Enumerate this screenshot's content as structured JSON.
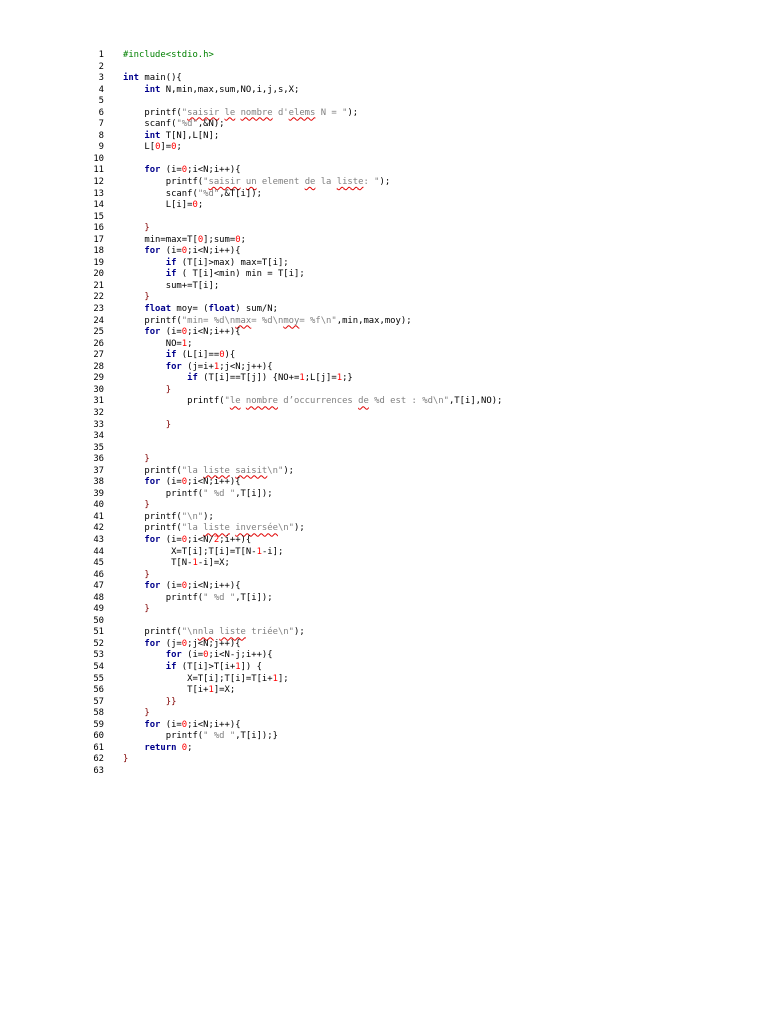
{
  "code": {
    "lines": [
      {
        "n": "1",
        "s": [
          {
            "t": "#include<stdio.h>",
            "c": "pp"
          }
        ]
      },
      {
        "n": "2",
        "s": []
      },
      {
        "n": "3",
        "s": [
          {
            "t": "int",
            "c": "kw"
          },
          {
            "t": " main(){"
          }
        ]
      },
      {
        "n": "4",
        "s": [
          {
            "t": "    "
          },
          {
            "t": "int",
            "c": "kw"
          },
          {
            "t": " N,min,max,sum,NO,i,j,s,X;"
          }
        ]
      },
      {
        "n": "5",
        "s": []
      },
      {
        "n": "6",
        "s": [
          {
            "t": "    printf("
          },
          {
            "t": "\"",
            "c": "str"
          },
          {
            "t": "saisir",
            "c": "str sq"
          },
          {
            "t": " ",
            "c": "str"
          },
          {
            "t": "le",
            "c": "str sq"
          },
          {
            "t": " ",
            "c": "str"
          },
          {
            "t": "nombre",
            "c": "str sq"
          },
          {
            "t": " d'",
            "c": "str"
          },
          {
            "t": "elems",
            "c": "str sq"
          },
          {
            "t": " N = \"",
            "c": "str"
          },
          {
            "t": ");"
          }
        ]
      },
      {
        "n": "7",
        "s": [
          {
            "t": "    scanf("
          },
          {
            "t": "\"%d\"",
            "c": "str"
          },
          {
            "t": ",&N);"
          }
        ]
      },
      {
        "n": "8",
        "s": [
          {
            "t": "    "
          },
          {
            "t": "int",
            "c": "kw"
          },
          {
            "t": " T[N],L[N];"
          }
        ]
      },
      {
        "n": "9",
        "s": [
          {
            "t": "    L["
          },
          {
            "t": "0",
            "c": "num"
          },
          {
            "t": "]="
          },
          {
            "t": "0",
            "c": "num"
          },
          {
            "t": ";"
          }
        ]
      },
      {
        "n": "10",
        "s": []
      },
      {
        "n": "11",
        "s": [
          {
            "t": "    "
          },
          {
            "t": "for",
            "c": "kw"
          },
          {
            "t": " (i="
          },
          {
            "t": "0",
            "c": "num"
          },
          {
            "t": ";i<N;i++){"
          }
        ]
      },
      {
        "n": "12",
        "s": [
          {
            "t": "        printf("
          },
          {
            "t": "\"",
            "c": "str"
          },
          {
            "t": "saisir",
            "c": "str sq"
          },
          {
            "t": " ",
            "c": "str"
          },
          {
            "t": "un",
            "c": "str sq"
          },
          {
            "t": " element ",
            "c": "str"
          },
          {
            "t": "de",
            "c": "str sq"
          },
          {
            "t": " la ",
            "c": "str"
          },
          {
            "t": "liste",
            "c": "str sq"
          },
          {
            "t": ": \"",
            "c": "str"
          },
          {
            "t": ");"
          }
        ]
      },
      {
        "n": "13",
        "s": [
          {
            "t": "        scanf("
          },
          {
            "t": "\"%d\"",
            "c": "str"
          },
          {
            "t": ",&T[i]);"
          }
        ]
      },
      {
        "n": "14",
        "s": [
          {
            "t": "        L[i]="
          },
          {
            "t": "0",
            "c": "num"
          },
          {
            "t": ";"
          }
        ]
      },
      {
        "n": "15",
        "s": []
      },
      {
        "n": "16",
        "s": [
          {
            "t": "    }",
            "c": "brace"
          }
        ]
      },
      {
        "n": "17",
        "s": [
          {
            "t": "    min=max=T["
          },
          {
            "t": "0",
            "c": "num"
          },
          {
            "t": "];sum="
          },
          {
            "t": "0",
            "c": "num"
          },
          {
            "t": ";"
          }
        ]
      },
      {
        "n": "18",
        "s": [
          {
            "t": "    "
          },
          {
            "t": "for",
            "c": "kw"
          },
          {
            "t": " (i="
          },
          {
            "t": "0",
            "c": "num"
          },
          {
            "t": ";i<N;i++){"
          }
        ]
      },
      {
        "n": "19",
        "s": [
          {
            "t": "        "
          },
          {
            "t": "if",
            "c": "kw"
          },
          {
            "t": " (T[i]>max) max=T[i];"
          }
        ]
      },
      {
        "n": "20",
        "s": [
          {
            "t": "        "
          },
          {
            "t": "if",
            "c": "kw"
          },
          {
            "t": " ( T[i]<min) min = T[i];"
          }
        ]
      },
      {
        "n": "21",
        "s": [
          {
            "t": "        sum+=T[i];"
          }
        ]
      },
      {
        "n": "22",
        "s": [
          {
            "t": "    }",
            "c": "brace"
          }
        ]
      },
      {
        "n": "23",
        "s": [
          {
            "t": "    "
          },
          {
            "t": "float",
            "c": "kw"
          },
          {
            "t": " moy= ("
          },
          {
            "t": "float",
            "c": "kw"
          },
          {
            "t": ") sum/N;"
          }
        ]
      },
      {
        "n": "24",
        "s": [
          {
            "t": "    printf("
          },
          {
            "t": "\"min= %d\\n",
            "c": "str"
          },
          {
            "t": "max",
            "c": "str sq"
          },
          {
            "t": "= %d\\n",
            "c": "str"
          },
          {
            "t": "moy",
            "c": "str sq"
          },
          {
            "t": "= %f\\n\"",
            "c": "str"
          },
          {
            "t": ",min,max,moy);"
          }
        ]
      },
      {
        "n": "25",
        "s": [
          {
            "t": "    "
          },
          {
            "t": "for",
            "c": "kw"
          },
          {
            "t": " (i="
          },
          {
            "t": "0",
            "c": "num"
          },
          {
            "t": ";i<N;i++){"
          }
        ]
      },
      {
        "n": "26",
        "s": [
          {
            "t": "        NO="
          },
          {
            "t": "1",
            "c": "num"
          },
          {
            "t": ";"
          }
        ]
      },
      {
        "n": "27",
        "s": [
          {
            "t": "        "
          },
          {
            "t": "if",
            "c": "kw"
          },
          {
            "t": " (L[i]=="
          },
          {
            "t": "0",
            "c": "num"
          },
          {
            "t": "){"
          }
        ]
      },
      {
        "n": "28",
        "s": [
          {
            "t": "        "
          },
          {
            "t": "for",
            "c": "kw"
          },
          {
            "t": " (j=i+"
          },
          {
            "t": "1",
            "c": "num"
          },
          {
            "t": ";j<N;j++){"
          }
        ]
      },
      {
        "n": "29",
        "s": [
          {
            "t": "            "
          },
          {
            "t": "if",
            "c": "kw"
          },
          {
            "t": " (T[i]==T[j]) {NO+="
          },
          {
            "t": "1",
            "c": "num"
          },
          {
            "t": ";L[j]="
          },
          {
            "t": "1",
            "c": "num"
          },
          {
            "t": ";}"
          }
        ]
      },
      {
        "n": "30",
        "s": [
          {
            "t": "        }",
            "c": "brace"
          }
        ]
      },
      {
        "n": "31",
        "s": [
          {
            "t": "            printf("
          },
          {
            "t": "\"",
            "c": "str"
          },
          {
            "t": "le",
            "c": "str sq"
          },
          {
            "t": " ",
            "c": "str"
          },
          {
            "t": "nombre",
            "c": "str sq"
          },
          {
            "t": " d’occurrences ",
            "c": "str"
          },
          {
            "t": "de",
            "c": "str sq"
          },
          {
            "t": " %d est : %d\\n\"",
            "c": "str"
          },
          {
            "t": ",T[i],NO);"
          }
        ]
      },
      {
        "n": "32",
        "s": []
      },
      {
        "n": "33",
        "s": [
          {
            "t": "        }",
            "c": "brace"
          }
        ]
      },
      {
        "n": "34",
        "s": []
      },
      {
        "n": "35",
        "s": []
      },
      {
        "n": "36",
        "s": [
          {
            "t": "    }",
            "c": "brace"
          }
        ]
      },
      {
        "n": "37",
        "s": [
          {
            "t": "    printf("
          },
          {
            "t": "\"la ",
            "c": "str"
          },
          {
            "t": "liste",
            "c": "str sq"
          },
          {
            "t": " ",
            "c": "str"
          },
          {
            "t": "saisit",
            "c": "str sq"
          },
          {
            "t": "\\n\"",
            "c": "str"
          },
          {
            "t": ");"
          }
        ]
      },
      {
        "n": "38",
        "s": [
          {
            "t": "    "
          },
          {
            "t": "for",
            "c": "kw"
          },
          {
            "t": " (i="
          },
          {
            "t": "0",
            "c": "num"
          },
          {
            "t": ";i<N;i++){"
          }
        ]
      },
      {
        "n": "39",
        "s": [
          {
            "t": "        printf("
          },
          {
            "t": "\" %d \"",
            "c": "str"
          },
          {
            "t": ",T[i]);"
          }
        ]
      },
      {
        "n": "40",
        "s": [
          {
            "t": "    }",
            "c": "brace"
          }
        ]
      },
      {
        "n": "41",
        "s": [
          {
            "t": "    printf("
          },
          {
            "t": "\"\\n\"",
            "c": "str"
          },
          {
            "t": ");"
          }
        ]
      },
      {
        "n": "42",
        "s": [
          {
            "t": "    printf("
          },
          {
            "t": "\"la ",
            "c": "str"
          },
          {
            "t": "liste",
            "c": "str sq"
          },
          {
            "t": " ",
            "c": "str"
          },
          {
            "t": "inversée",
            "c": "str sq"
          },
          {
            "t": "\\n\"",
            "c": "str"
          },
          {
            "t": ");"
          }
        ]
      },
      {
        "n": "43",
        "s": [
          {
            "t": "    "
          },
          {
            "t": "for",
            "c": "kw"
          },
          {
            "t": " (i="
          },
          {
            "t": "0",
            "c": "num"
          },
          {
            "t": ";i<N/"
          },
          {
            "t": "2",
            "c": "num"
          },
          {
            "t": ";i++){"
          }
        ]
      },
      {
        "n": "44",
        "s": [
          {
            "t": "         X=T[i];T[i]=T[N-"
          },
          {
            "t": "1",
            "c": "num"
          },
          {
            "t": "-i];"
          }
        ]
      },
      {
        "n": "45",
        "s": [
          {
            "t": "         T[N-"
          },
          {
            "t": "1",
            "c": "num"
          },
          {
            "t": "-i]=X;"
          }
        ]
      },
      {
        "n": "46",
        "s": [
          {
            "t": "    }",
            "c": "brace"
          }
        ]
      },
      {
        "n": "47",
        "s": [
          {
            "t": "    "
          },
          {
            "t": "for",
            "c": "kw"
          },
          {
            "t": " (i="
          },
          {
            "t": "0",
            "c": "num"
          },
          {
            "t": ";i<N;i++){"
          }
        ]
      },
      {
        "n": "48",
        "s": [
          {
            "t": "        printf("
          },
          {
            "t": "\" %d \"",
            "c": "str"
          },
          {
            "t": ",T[i]);"
          }
        ]
      },
      {
        "n": "49",
        "s": [
          {
            "t": "    }",
            "c": "brace"
          }
        ]
      },
      {
        "n": "50",
        "s": []
      },
      {
        "n": "51",
        "s": [
          {
            "t": "    printf("
          },
          {
            "t": "\"\\n",
            "c": "str"
          },
          {
            "t": "nla",
            "c": "str sq"
          },
          {
            "t": " ",
            "c": "str"
          },
          {
            "t": "liste",
            "c": "str sq"
          },
          {
            "t": " triée\\n\"",
            "c": "str"
          },
          {
            "t": ");"
          }
        ]
      },
      {
        "n": "52",
        "s": [
          {
            "t": "    "
          },
          {
            "t": "for",
            "c": "kw"
          },
          {
            "t": " (j="
          },
          {
            "t": "0",
            "c": "num"
          },
          {
            "t": ";j<N;j++){"
          }
        ]
      },
      {
        "n": "53",
        "s": [
          {
            "t": "        "
          },
          {
            "t": "for",
            "c": "kw"
          },
          {
            "t": " (i="
          },
          {
            "t": "0",
            "c": "num"
          },
          {
            "t": ";i<N-j;i++){"
          }
        ]
      },
      {
        "n": "54",
        "s": [
          {
            "t": "        "
          },
          {
            "t": "if",
            "c": "kw"
          },
          {
            "t": " (T[i]>T[i+"
          },
          {
            "t": "1",
            "c": "num"
          },
          {
            "t": "]) {"
          }
        ]
      },
      {
        "n": "55",
        "s": [
          {
            "t": "            X=T[i];T[i]=T[i+"
          },
          {
            "t": "1",
            "c": "num"
          },
          {
            "t": "];"
          }
        ]
      },
      {
        "n": "56",
        "s": [
          {
            "t": "            T[i+"
          },
          {
            "t": "1",
            "c": "num"
          },
          {
            "t": "]=X;"
          }
        ]
      },
      {
        "n": "57",
        "s": [
          {
            "t": "        }}",
            "c": "brace"
          }
        ]
      },
      {
        "n": "58",
        "s": [
          {
            "t": "    }",
            "c": "brace"
          }
        ]
      },
      {
        "n": "59",
        "s": [
          {
            "t": "    "
          },
          {
            "t": "for",
            "c": "kw"
          },
          {
            "t": " (i="
          },
          {
            "t": "0",
            "c": "num"
          },
          {
            "t": ";i<N;i++){"
          }
        ]
      },
      {
        "n": "60",
        "s": [
          {
            "t": "        printf("
          },
          {
            "t": "\" %d \"",
            "c": "str"
          },
          {
            "t": ",T[i]);}"
          }
        ]
      },
      {
        "n": "61",
        "s": [
          {
            "t": "    "
          },
          {
            "t": "return",
            "c": "kw"
          },
          {
            "t": " "
          },
          {
            "t": "0",
            "c": "num"
          },
          {
            "t": ";"
          }
        ]
      },
      {
        "n": "62",
        "s": [
          {
            "t": "}",
            "c": "brace"
          }
        ]
      },
      {
        "n": "63",
        "s": []
      }
    ]
  },
  "colors": {
    "keyword": "#00008b",
    "preprocessor": "#008000",
    "string": "#808080",
    "number": "#ff0000",
    "brace": "#800000",
    "spellcheck": "#e00000"
  }
}
